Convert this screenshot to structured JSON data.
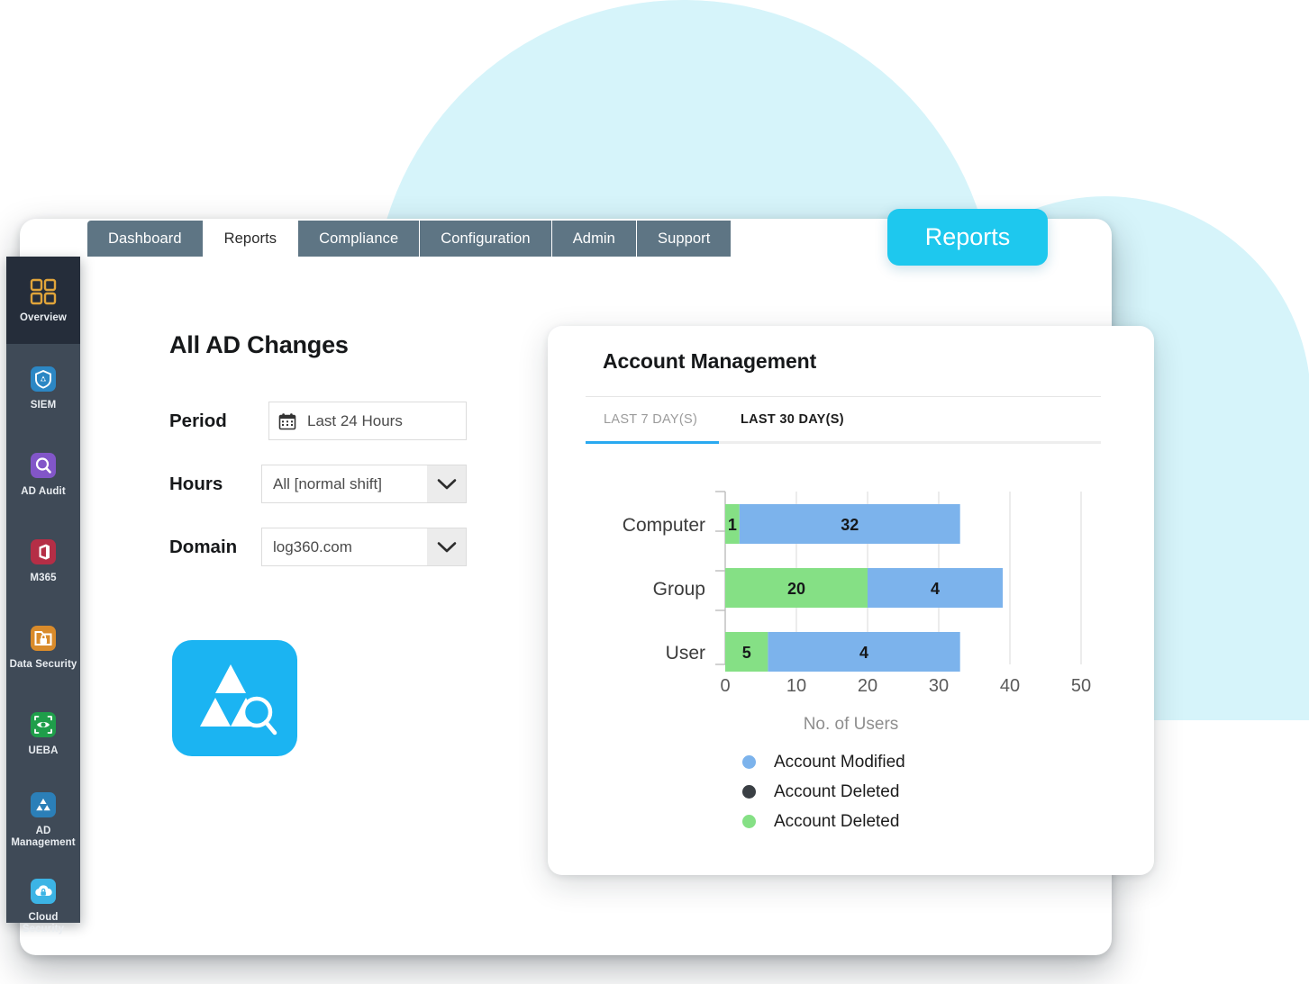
{
  "backdrop": {
    "cloud_color": "#d6f4fa"
  },
  "floating_badge": {
    "label": "Reports",
    "color": "#1ec8ee"
  },
  "topnav": {
    "tabs": [
      {
        "label": "Dashboard",
        "active": false
      },
      {
        "label": "Reports",
        "active": true
      },
      {
        "label": "Compliance",
        "active": false
      },
      {
        "label": "Configuration",
        "active": false
      },
      {
        "label": "Admin",
        "active": false
      },
      {
        "label": "Support",
        "active": false
      }
    ]
  },
  "sidebar": {
    "items": [
      {
        "label": "Overview",
        "icon": "grid-squares-icon",
        "active": true,
        "icon_color": "#e0a43a"
      },
      {
        "label": "SIEM",
        "icon": "shield-icon",
        "active": false,
        "icon_color": "#2c87c4"
      },
      {
        "label": "AD Audit",
        "icon": "magnifier-icon",
        "active": false,
        "icon_color": "#8256c8"
      },
      {
        "label": "M365",
        "icon": "office-icon",
        "active": false,
        "icon_color": "#b52e46"
      },
      {
        "label": "Data Security",
        "icon": "folder-lock-icon",
        "active": false,
        "icon_color": "#d98b2b"
      },
      {
        "label": "UEBA",
        "icon": "eye-icon",
        "active": false,
        "icon_color": "#1f9e4a"
      },
      {
        "label": "AD Management",
        "icon": "triangles-icon",
        "active": false,
        "icon_color": "#2b7fb8"
      },
      {
        "label": "Cloud Security",
        "icon": "cloud-lock-icon",
        "active": false,
        "icon_color": "#3cb4e5"
      }
    ]
  },
  "report_form": {
    "title": "All AD Changes",
    "fields": [
      {
        "label": "Period",
        "value": "Last 24 Hours",
        "icon": "calendar-icon",
        "type": "date-picker"
      },
      {
        "label": "Hours",
        "value": "All [normal shift]",
        "icon": "chevron-down-icon",
        "type": "select"
      },
      {
        "label": "Domain",
        "value": "log360.com",
        "icon": "chevron-down-icon",
        "type": "select"
      }
    ]
  },
  "product_logo": {
    "name": "adaudit-plus-logo",
    "background": "#1bb4f2"
  },
  "chart_card": {
    "title": "Account Management",
    "tabs": [
      {
        "label": "LAST 7 DAY(S)",
        "active": true
      },
      {
        "label": "LAST 30 DAY(S)",
        "active": false
      }
    ],
    "accent": "#29a9f0"
  },
  "chart_data": {
    "type": "bar",
    "orientation": "horizontal",
    "stacked": true,
    "title": "Account Management",
    "xlabel": "No. of Users",
    "ylabel": "",
    "xlim": [
      0,
      50
    ],
    "xticks": [
      0,
      10,
      20,
      30,
      40,
      50
    ],
    "grid": true,
    "legend_position": "bottom-left",
    "categories": [
      "Computer",
      "Group",
      "User"
    ],
    "series": [
      {
        "name": "Account Deleted",
        "color": "#85e085",
        "values": [
          2,
          20,
          6
        ],
        "labels": [
          "1",
          "20",
          "5"
        ]
      },
      {
        "name": "Account Modified",
        "color": "#7cb3ec",
        "values": [
          31,
          19,
          27
        ],
        "labels": [
          "32",
          "4",
          "4"
        ]
      }
    ],
    "legend": [
      {
        "label": "Account Modified",
        "color": "#7cb3ec"
      },
      {
        "label": "Account Deleted",
        "color": "#3a3f44"
      },
      {
        "label": "Account Deleted",
        "color": "#85e085"
      }
    ]
  }
}
